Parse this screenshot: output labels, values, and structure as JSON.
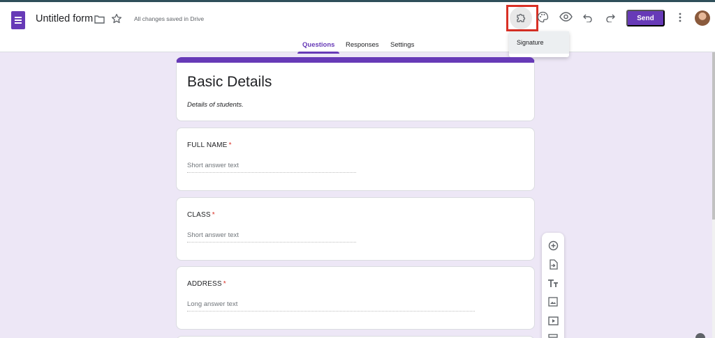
{
  "header": {
    "doc_title": "Untitled form",
    "save_status": "All changes saved in Drive",
    "send_label": "Send"
  },
  "tabs": [
    {
      "label": "Questions",
      "active": true
    },
    {
      "label": "Responses",
      "active": false
    },
    {
      "label": "Settings",
      "active": false
    }
  ],
  "addons_menu": {
    "items": [
      "Signature"
    ]
  },
  "form": {
    "title": "Basic Details",
    "description": "Details of students.",
    "questions": [
      {
        "label": "FULL NAME",
        "required_mark": "*",
        "answer_placeholder": "Short answer text",
        "type": "short"
      },
      {
        "label": "CLASS",
        "required_mark": "*",
        "answer_placeholder": "Short answer text",
        "type": "short"
      },
      {
        "label": "ADDRESS",
        "required_mark": "*",
        "answer_placeholder": "Long answer text",
        "type": "long"
      }
    ]
  },
  "side_toolbar": {
    "icons": [
      "add-question-icon",
      "import-questions-icon",
      "add-title-icon",
      "add-image-icon",
      "add-video-icon",
      "add-section-icon"
    ]
  },
  "colors": {
    "accent": "#673ab7",
    "background": "#ede7f6",
    "highlight": "#d93025",
    "required": "#d93025"
  }
}
